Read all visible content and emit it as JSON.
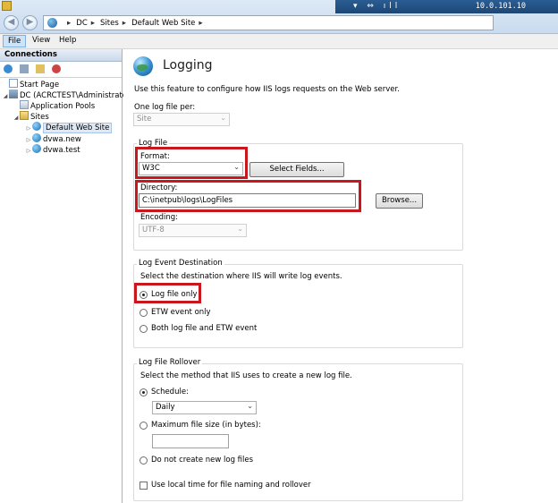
{
  "remote": {
    "ip": "10.0.101.10"
  },
  "address": {
    "crumbs": [
      "DC",
      "Sites",
      "Default Web Site"
    ]
  },
  "menu": [
    "File",
    "View",
    "Help"
  ],
  "connections": {
    "title": "Connections",
    "tree": [
      {
        "label": "Start Page"
      },
      {
        "label": "DC (ACRCTEST\\Administrato"
      },
      {
        "label": "Application Pools"
      },
      {
        "label": "Sites"
      },
      {
        "label": "Default Web Site"
      },
      {
        "label": "dvwa.new"
      },
      {
        "label": "dvwa.test"
      }
    ]
  },
  "logging": {
    "title": "Logging",
    "description": "Use this feature to configure how IIS logs requests on the Web server.",
    "one_log_label": "One log file per:",
    "one_log_value": "Site",
    "log_file": {
      "group": "Log File",
      "format_label": "Format:",
      "format_value": "W3C",
      "select_fields": "Select Fields...",
      "directory_label": "Directory:",
      "directory_value": "C:\\inetpub\\logs\\LogFiles",
      "browse": "Browse...",
      "encoding_label": "Encoding:",
      "encoding_value": "UTF-8"
    },
    "destination": {
      "group": "Log Event Destination",
      "desc": "Select the destination where IIS will write log events.",
      "options": [
        "Log file only",
        "ETW event only",
        "Both log file and ETW event"
      ],
      "selected": 0
    },
    "rollover": {
      "group": "Log File Rollover",
      "desc": "Select the method that IIS uses to create a new log file.",
      "schedule_label": "Schedule:",
      "schedule_value": "Daily",
      "max_size_label": "Maximum file size (in bytes):",
      "max_size_value": "",
      "no_new_label": "Do not create new log files",
      "local_time_label": "Use local time for file naming and rollover",
      "local_time_checked": false
    }
  },
  "highlight_color": "#c8181e"
}
